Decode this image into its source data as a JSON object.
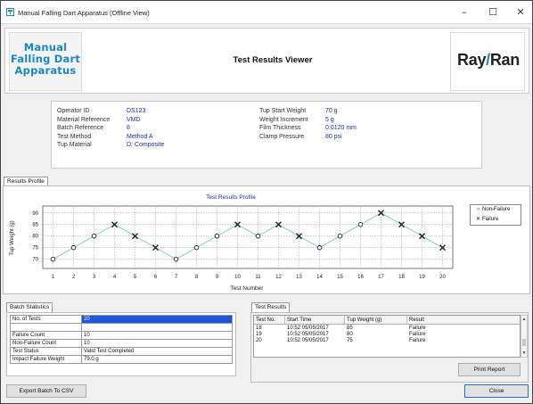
{
  "window": {
    "title": "Manual Falling Dart Apparatus (Offline View)",
    "controls": {
      "minimize": "–",
      "maximize": "☐",
      "close": "✕"
    }
  },
  "header": {
    "logo_left_lines": [
      "Manual",
      "Falling Dart",
      "Apparatus"
    ],
    "viewer_title": "Test Results Viewer",
    "logo_right_parts": [
      "Ray",
      "/",
      "Ran"
    ]
  },
  "test_info": {
    "left": [
      {
        "label": "Operator ID",
        "value": "DS123"
      },
      {
        "label": "Material Reference",
        "value": "VMD"
      },
      {
        "label": "Batch Reference",
        "value": "8"
      },
      {
        "label": "Test Method",
        "value": "Method A"
      },
      {
        "label": "Tup Material",
        "value": "D: Composite"
      }
    ],
    "right": [
      {
        "label": "Tup Start Weight",
        "value": "70 g"
      },
      {
        "label": "Weight Increment",
        "value": "5 g"
      },
      {
        "label": "Film Thickness",
        "value": "0.0120 mm"
      },
      {
        "label": "Clamp Pressure",
        "value": "80 psi"
      }
    ]
  },
  "results_profile_tab": "Results Profile",
  "chart_data": {
    "type": "scatter",
    "title": "Test Results Profile",
    "xlabel": "Test Number",
    "ylabel": "Tup Weight (g)",
    "x": [
      1,
      2,
      3,
      4,
      5,
      6,
      7,
      8,
      9,
      10,
      11,
      12,
      13,
      14,
      15,
      16,
      17,
      18,
      19,
      20
    ],
    "y": [
      70,
      75,
      80,
      85,
      80,
      75,
      70,
      75,
      80,
      85,
      80,
      85,
      80,
      75,
      80,
      85,
      90,
      85,
      80,
      75
    ],
    "result": [
      "Non-Failure",
      "Non-Failure",
      "Non-Failure",
      "Failure",
      "Failure",
      "Failure",
      "Non-Failure",
      "Non-Failure",
      "Non-Failure",
      "Failure",
      "Non-Failure",
      "Failure",
      "Failure",
      "Non-Failure",
      "Non-Failure",
      "Non-Failure",
      "Failure",
      "Failure",
      "Failure",
      "Failure"
    ],
    "x_ticks": [
      "1",
      "2",
      "3",
      "4",
      "5",
      "6",
      "7",
      "8",
      "9",
      "10",
      "11",
      "12",
      "13",
      "14",
      "15",
      "16",
      "17",
      "18",
      "19",
      "20"
    ],
    "y_ticks": [
      "70",
      "75",
      "80",
      "85",
      "90"
    ],
    "xlim": [
      0.5,
      20.5
    ],
    "ylim": [
      66,
      93
    ],
    "grid": true,
    "legend": {
      "placement": "right",
      "entries": [
        "Non-Failure",
        "Failure"
      ]
    },
    "colors": {
      "line": "#7fd0c4",
      "marker": "#222222",
      "grid": "#999999"
    }
  },
  "batch_statistics": {
    "tab": "Batch Statistics",
    "rows": [
      {
        "label": "No. of Tests",
        "value": "20"
      },
      {
        "label": "",
        "value": ""
      },
      {
        "label": "Failure Count",
        "value": "10"
      },
      {
        "label": "Non-Failure Count",
        "value": "10"
      },
      {
        "label": "Test Status",
        "value": "Valid Test Completed"
      },
      {
        "label": "Impact Failure Weight",
        "value": "79.0 g"
      }
    ]
  },
  "test_results": {
    "tab": "Test Results",
    "columns": [
      "Test No.",
      "Start Time",
      "Tup Weight (g)",
      "Result"
    ],
    "rows": [
      [
        "18",
        "10:52 05/05/2017",
        "85",
        "Failure"
      ],
      [
        "19",
        "10:52 05/05/2017",
        "80",
        "Failure"
      ],
      [
        "20",
        "10:52 05/05/2017",
        "75",
        "Failure"
      ]
    ],
    "print_button": "Print Report"
  },
  "footer": {
    "export_button": "Export Batch To CSV",
    "close_button": "Close"
  },
  "colors": {
    "accent": "#1a88c9",
    "selection": "#1b57d6",
    "value_text": "#1e2fa8"
  }
}
